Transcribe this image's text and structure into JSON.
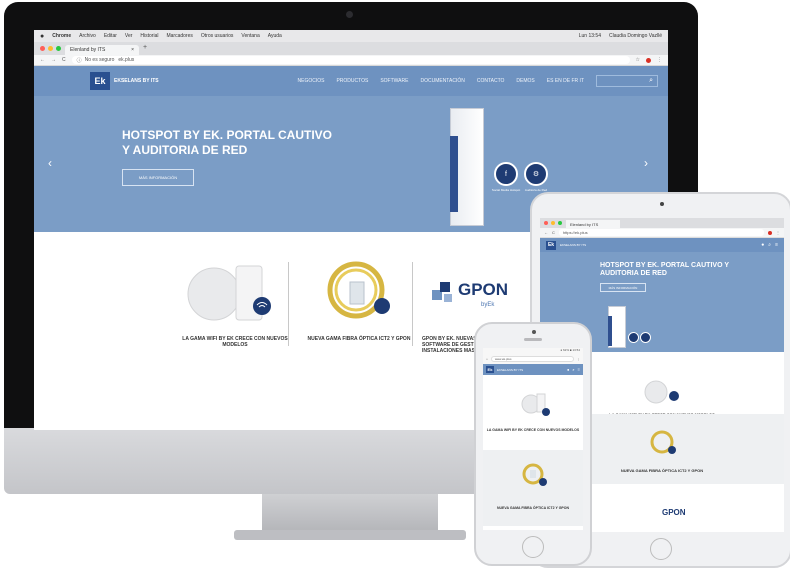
{
  "browser": {
    "menubar": {
      "app": "Chrome",
      "items": [
        "Archivo",
        "Editar",
        "Ver",
        "Historial",
        "Marcadores",
        "Otros usuarios",
        "Ventana",
        "Ayuda"
      ],
      "clock": "Lun 13:54",
      "user": "Claudia Domingo Vazllé"
    },
    "tab_title": "Elenland by ITS",
    "address_security": "No es seguro",
    "address_url": "ek.plus"
  },
  "site": {
    "logo": "Ek",
    "brand": "EKSELANS BY ITS",
    "nav": [
      "NEGOCIOS",
      "PRODUCTOS",
      "SOFTWARE",
      "DOCUMENTACIÓN",
      "CONTACTO",
      "DEMOS",
      "ES EN DE FR IT"
    ],
    "hero_title": "HOTSPOT BY EK. PORTAL CAUTIVO Y AUDITORIA DE RED",
    "hero_button": "MÁS INFORMACIÓN",
    "prev_arrow": "‹",
    "next_arrow": "›",
    "badge_1_label": "Social Media Hotspot",
    "badge_2_label": "Auditoria de Red",
    "products": [
      {
        "caption": "LA GAMA WIFI BY EK CRECE CON NUEVOS MODELOS"
      },
      {
        "caption": "NUEVA GAMA FIBRA ÓPTICA ICT2 Y GPON"
      },
      {
        "caption": "GPON BY EK. NUEVAS OLT Y SOFTWARE DE GESTIÓN PARA INSTALACIONES MASIVAS"
      }
    ],
    "gpon_logo": "GPON",
    "gpon_sub": "byEk"
  },
  "ipad": {
    "url": "https://ek.plus",
    "hero_title": "HOTSPOT BY EK. PORTAL CAUTIVO Y AUDITORIA DE RED",
    "hero_button": "MÁS INFORMACIÓN",
    "caption_1": "LA GAMA WIFI BY EK CRECE CON NUEVOS MODELOS",
    "caption_2": "NUEVA GAMA FIBRA ÓPTICA ICT2 Y GPON",
    "gpon": "GPON"
  },
  "iphone": {
    "status": "● 62% ■ 13:54",
    "url": "www.ek.plus",
    "caption_1": "LA GAMA WIFI BY EK CRECE CON NUEVOS MODELOS",
    "caption_2": "NUEVA GAMA FIBRA ÓPTICA ICT2 Y GPON"
  },
  "colors": {
    "brand_blue": "#7b9dc6",
    "nav_blue": "#6e92c0",
    "dark_blue": "#1e3b73"
  }
}
